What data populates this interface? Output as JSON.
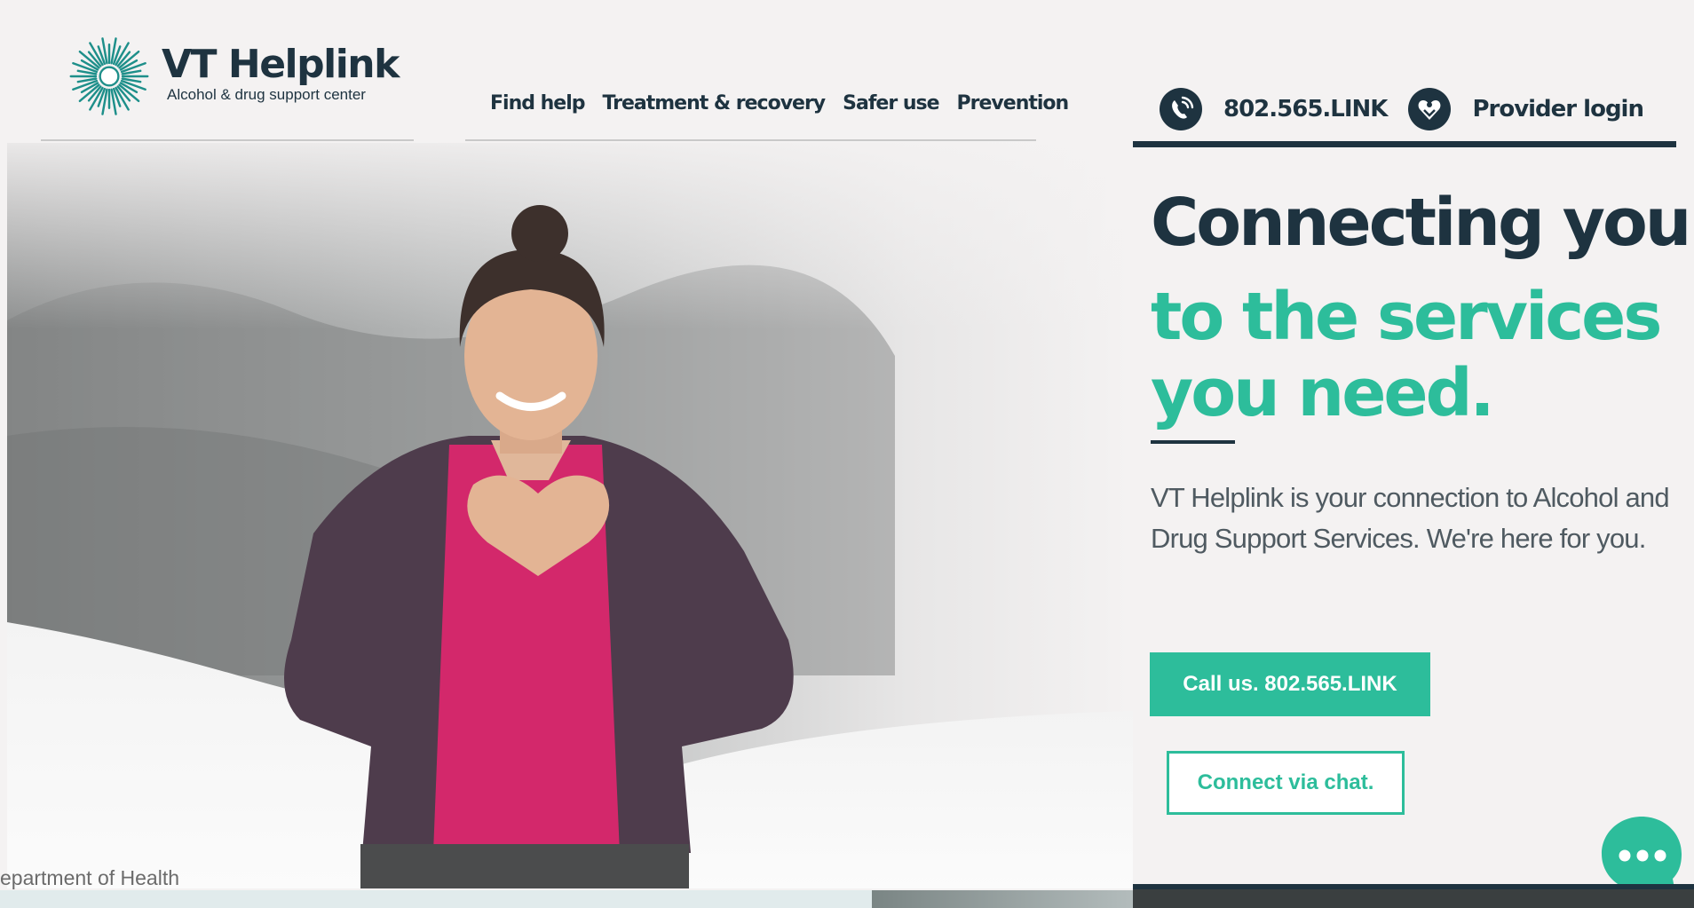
{
  "brand": {
    "name": "VT Helplink",
    "tagline": "Alcohol & drug support center"
  },
  "nav": {
    "items": [
      {
        "label": "Find help"
      },
      {
        "label": "Treatment & recovery"
      },
      {
        "label": "Safer use"
      },
      {
        "label": "Prevention"
      }
    ]
  },
  "utility": {
    "phone_label": "802.565.LINK",
    "phone_icon": "phone-icon",
    "provider_label": "Provider login",
    "provider_icon": "provider-heart-icon"
  },
  "hero": {
    "headline_line1": "Connecting you",
    "headline_line2": "to the services you need.",
    "intro": "VT Helplink is your connection to Alcohol and Drug Support Services. We're here for you.",
    "call_button": "Call us. 802.565.LINK",
    "chat_button": "Connect via chat.",
    "photo": "woman-making-heart-hands"
  },
  "chat_widget": {
    "icon": "chat-bubble-icon"
  },
  "footer": {
    "partial_text": "epartment of Health"
  },
  "colors": {
    "navy": "#1e3340",
    "teal": "#2dbd9b",
    "background": "#f4f2f2",
    "magenta": "#d3286b",
    "cardigan": "#4e3c4c"
  }
}
